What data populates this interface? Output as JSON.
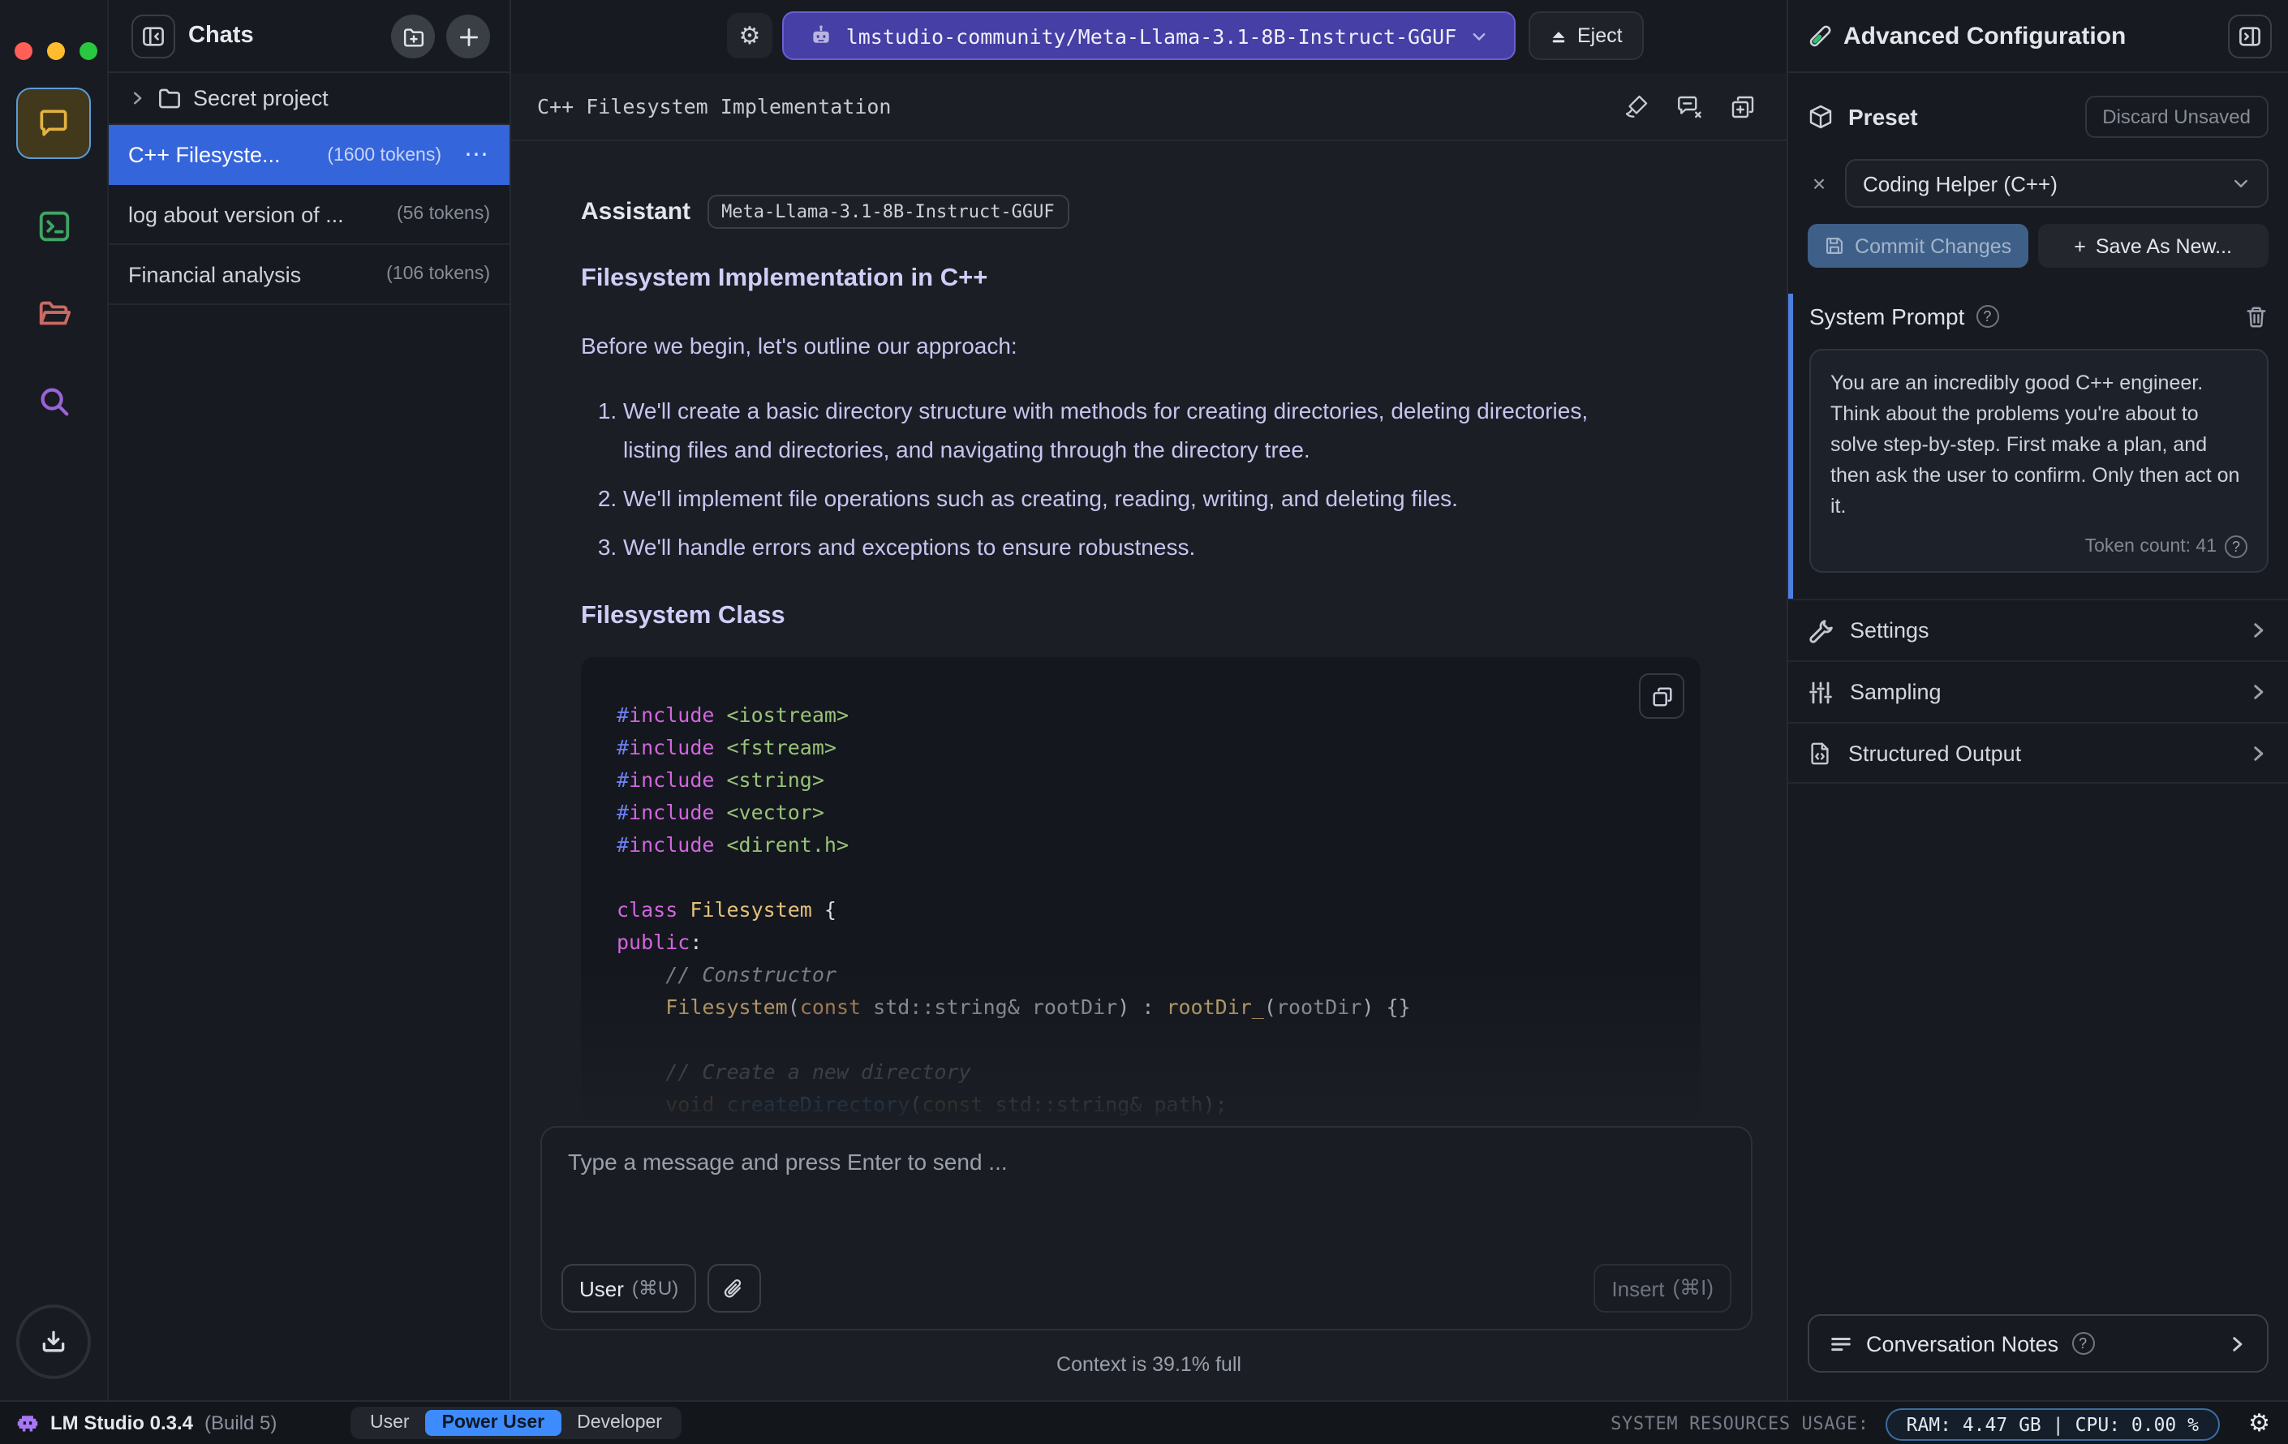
{
  "glyphs": {
    "close_x": "×",
    "ellipsis": "⋯",
    "plus": "+",
    "question": "?",
    "pipe": "|",
    "gear": "⚙"
  },
  "sidebar": {
    "title": "Chats",
    "folder_label": "Secret project",
    "chats": [
      {
        "title": "C++ Filesyste...",
        "tokens": "(1600 tokens)",
        "selected": true
      },
      {
        "title": "log about version of ...",
        "tokens": "(56 tokens)",
        "selected": false
      },
      {
        "title": "Financial analysis",
        "tokens": "(106 tokens)",
        "selected": false
      }
    ]
  },
  "topbar": {
    "model_label": "lmstudio-community/Meta-Llama-3.1-8B-Instruct-GGUF",
    "eject_label": "Eject"
  },
  "chat": {
    "title": "C++ Filesystem Implementation",
    "role_label": "Assistant",
    "model_badge": "Meta-Llama-3.1-8B-Instruct-GGUF",
    "heading_main": "Filesystem Implementation in C++",
    "intro": "Before we begin, let's outline our approach:",
    "steps": [
      "We'll create a basic directory structure with methods for creating directories, deleting directories, listing files and directories, and navigating through the directory tree.",
      "We'll implement file operations such as creating, reading, writing, and deleting files.",
      "We'll handle errors and exceptions to ensure robustness."
    ],
    "heading_code": "Filesystem Class"
  },
  "code": {
    "lines": [
      [
        {
          "c": "pp",
          "t": "#"
        },
        {
          "c": "kw",
          "t": "include"
        },
        {
          "c": "pl",
          "t": " "
        },
        {
          "c": "inc",
          "t": "<iostream>"
        }
      ],
      [
        {
          "c": "pp",
          "t": "#"
        },
        {
          "c": "kw",
          "t": "include"
        },
        {
          "c": "pl",
          "t": " "
        },
        {
          "c": "inc",
          "t": "<fstream>"
        }
      ],
      [
        {
          "c": "pp",
          "t": "#"
        },
        {
          "c": "kw",
          "t": "include"
        },
        {
          "c": "pl",
          "t": " "
        },
        {
          "c": "inc",
          "t": "<string>"
        }
      ],
      [
        {
          "c": "pp",
          "t": "#"
        },
        {
          "c": "kw",
          "t": "include"
        },
        {
          "c": "pl",
          "t": " "
        },
        {
          "c": "inc",
          "t": "<vector>"
        }
      ],
      [
        {
          "c": "pp",
          "t": "#"
        },
        {
          "c": "kw",
          "t": "include"
        },
        {
          "c": "pl",
          "t": " "
        },
        {
          "c": "inc",
          "t": "<dirent.h>"
        }
      ],
      [],
      [
        {
          "c": "kw",
          "t": "class"
        },
        {
          "c": "pl",
          "t": " "
        },
        {
          "c": "typ",
          "t": "Filesystem"
        },
        {
          "c": "wh",
          "t": " {"
        }
      ],
      [
        {
          "c": "kw",
          "t": "public"
        },
        {
          "c": "wh",
          "t": ":"
        }
      ],
      [
        {
          "c": "pl",
          "t": "    "
        },
        {
          "c": "com",
          "t": "// Constructor"
        }
      ],
      [
        {
          "c": "pl",
          "t": "    "
        },
        {
          "c": "typ",
          "t": "Filesystem"
        },
        {
          "c": "wh",
          "t": "("
        },
        {
          "c": "kw2",
          "t": "const"
        },
        {
          "c": "pl",
          "t": " std::string& rootDir"
        },
        {
          "c": "wh",
          "t": ")"
        },
        {
          "c": "pl",
          "t": " "
        },
        {
          "c": "wh",
          "t": ":"
        },
        {
          "c": "pl",
          "t": " "
        },
        {
          "c": "typ",
          "t": "rootDir_"
        },
        {
          "c": "wh",
          "t": "("
        },
        {
          "c": "pl",
          "t": "rootDir"
        },
        {
          "c": "wh",
          "t": ")"
        },
        {
          "c": "pl",
          "t": " "
        },
        {
          "c": "wh",
          "t": "{}"
        }
      ],
      [],
      [
        {
          "c": "pl",
          "t": "    "
        },
        {
          "c": "com",
          "t": "// Create a new directory"
        }
      ],
      [
        {
          "c": "pl",
          "t": "    "
        },
        {
          "c": "kw2",
          "t": "void"
        },
        {
          "c": "pl",
          "t": " "
        },
        {
          "c": "fn",
          "t": "createDirectory"
        },
        {
          "c": "wh",
          "t": "("
        },
        {
          "c": "kw2",
          "t": "const"
        },
        {
          "c": "pl",
          "t": " std::string& path"
        },
        {
          "c": "wh",
          "t": ");"
        }
      ]
    ]
  },
  "composer": {
    "placeholder": "Type a message and press Enter to send ...",
    "role_button": "User",
    "role_shortcut": "(⌘U)",
    "insert_label": "Insert",
    "insert_shortcut": "(⌘I)",
    "context_note": "Context is 39.1% full"
  },
  "panel": {
    "title": "Advanced Configuration",
    "preset": {
      "label": "Preset",
      "discard_label": "Discard Unsaved",
      "value": "Coding Helper (C++)",
      "commit_label": "Commit Changes",
      "save_label": "Save As New..."
    },
    "system_prompt": {
      "label": "System Prompt",
      "text": "You are an incredibly good C++ engineer. Think about the problems you're about to solve step-by-step. First make a plan, and then ask the user to confirm. Only then act on it.",
      "token_count": "Token count: 41"
    },
    "sections": [
      {
        "label": "Settings"
      },
      {
        "label": "Sampling"
      },
      {
        "label": "Structured Output"
      }
    ],
    "conversation_notes_label": "Conversation Notes"
  },
  "statusbar": {
    "app_name": "LM Studio 0.3.4",
    "build": "(Build 5)",
    "modes": [
      {
        "label": "User",
        "selected": false
      },
      {
        "label": "Power User",
        "selected": true
      },
      {
        "label": "Developer",
        "selected": false
      }
    ],
    "resources_label": "SYSTEM RESOURCES USAGE:",
    "ram": "RAM: 4.47 GB",
    "cpu": "CPU: 0.00 %"
  },
  "colors": {
    "selected_chat": "#3565db",
    "model_pill": "#463fa5",
    "accent_blue": "#4d7fe0",
    "power_user_pill": "#3d8bfd",
    "traffic_red": "#ff5f57",
    "traffic_yellow": "#febc2e",
    "traffic_green": "#28c840",
    "rail_chat_icon": "#e3b341",
    "rail_terminal_icon": "#3fa564",
    "rail_folder_icon": "#c96a62",
    "rail_search_icon": "#9a63d8",
    "test_tube_green": "#2fbf71"
  }
}
